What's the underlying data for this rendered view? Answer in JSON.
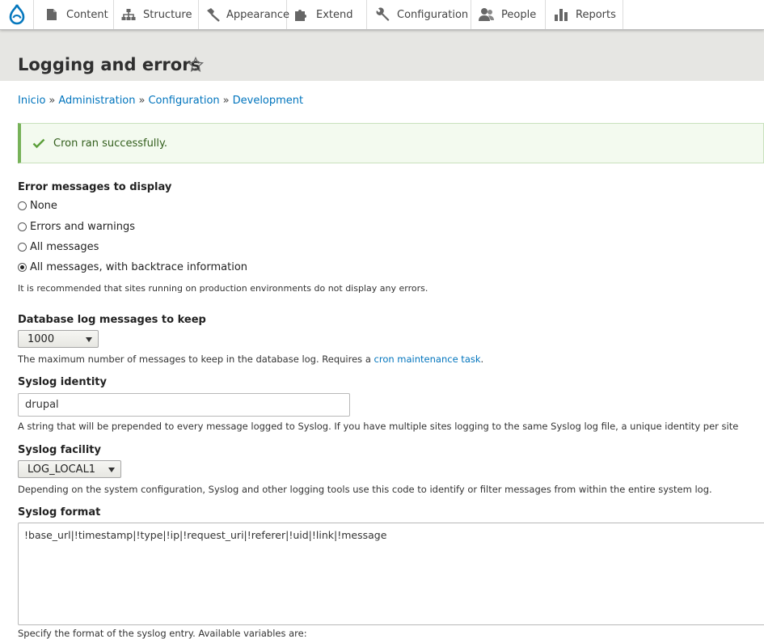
{
  "toolbar": {
    "items": [
      {
        "label": "Content",
        "icon": "file-icon"
      },
      {
        "label": "Structure",
        "icon": "sitemap-icon"
      },
      {
        "label": "Appearance",
        "icon": "paintbrush-icon"
      },
      {
        "label": "Extend",
        "icon": "puzzle-icon"
      },
      {
        "label": "Configuration",
        "icon": "wrench-icon"
      },
      {
        "label": "People",
        "icon": "people-icon"
      },
      {
        "label": "Reports",
        "icon": "bar-chart-icon"
      }
    ]
  },
  "page": {
    "title": "Logging and errors"
  },
  "breadcrumb": {
    "items": [
      "Inicio",
      "Administration",
      "Configuration",
      "Development"
    ],
    "separator": "»"
  },
  "message": {
    "text": "Cron ran successfully.",
    "accent": "#77b259"
  },
  "error_display": {
    "label": "Error messages to display",
    "options": [
      "None",
      "Errors and warnings",
      "All messages",
      "All messages, with backtrace information"
    ],
    "selected": "All messages, with backtrace information",
    "description": "It is recommended that sites running on production environments do not display any errors."
  },
  "dblog": {
    "label": "Database log messages to keep",
    "value": "1000",
    "description_pre": "The maximum number of messages to keep in the database log. Requires a ",
    "description_link": "cron maintenance task",
    "description_post": "."
  },
  "syslog_identity": {
    "label": "Syslog identity",
    "value": "drupal",
    "description": "A string that will be prepended to every message logged to Syslog. If you have multiple sites logging to the same Syslog log file, a unique identity per site"
  },
  "syslog_facility": {
    "label": "Syslog facility",
    "value": "LOG_LOCAL1",
    "description": "Depending on the system configuration, Syslog and other logging tools use this code to identify or filter messages from within the entire system log."
  },
  "syslog_format": {
    "label": "Syslog format",
    "value": "!base_url|!timestamp|!type|!ip|!request_uri|!referer|!uid|!link|!message",
    "description_cut": "Specify the format of the syslog entry. Available variables are:"
  },
  "colors": {
    "link": "#0074bd",
    "header_bg": "#e6e6e3",
    "success": "#77b259"
  }
}
